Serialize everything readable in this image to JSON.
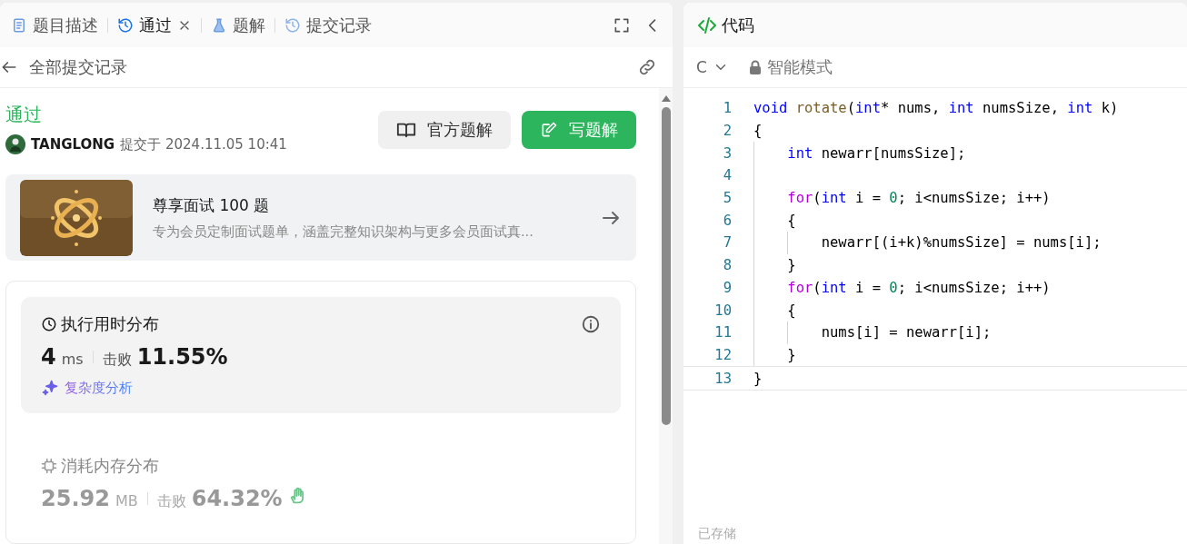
{
  "left_panel": {
    "tabs": [
      {
        "label": "题目描述",
        "kind": "document",
        "selected": false,
        "closable": false
      },
      {
        "label": "通过",
        "kind": "history",
        "selected": true,
        "closable": true
      },
      {
        "label": "题解",
        "kind": "flask",
        "selected": false,
        "closable": false
      },
      {
        "label": "提交记录",
        "kind": "history",
        "selected": false,
        "closable": false
      }
    ],
    "subheader": {
      "title": "全部提交记录"
    },
    "submission": {
      "status": "通过",
      "author": "TANGLONG",
      "submitted": "提交于 2024.11.05 10:41",
      "buttons": [
        {
          "label": "官方题解",
          "kind": "secondary"
        },
        {
          "label": "写题解",
          "kind": "primary"
        }
      ]
    },
    "promo": {
      "title": "尊享面试 100 题",
      "description": "专为会员定制面试题单，涵盖完整知识架构与更多会员面试真..."
    },
    "stats": [
      {
        "kind": "runtime",
        "title": "执行用时分布",
        "value": "4",
        "unit": "ms",
        "beat_label": "击败",
        "beat": "11.55%",
        "link": "复杂度分析",
        "selected": true
      },
      {
        "kind": "memory",
        "title": "消耗内存分布",
        "value": "25.92",
        "unit": "MB",
        "beat_label": "击败",
        "beat": "64.32%",
        "selected": false
      }
    ]
  },
  "code_panel": {
    "title": "代码",
    "language": "C",
    "mode": "智能模式",
    "status": "已存储",
    "lines": [
      {
        "number": "1",
        "tokens": [
          {
            "text": "void ",
            "kind": "keyword"
          },
          {
            "text": "rotate",
            "kind": "function"
          },
          {
            "text": "(",
            "kind": "plain"
          },
          {
            "text": "int",
            "kind": "keyword"
          },
          {
            "text": "* nums, ",
            "kind": "plain"
          },
          {
            "text": "int",
            "kind": "keyword"
          },
          {
            "text": " numsSize, ",
            "kind": "plain"
          },
          {
            "text": "int",
            "kind": "keyword"
          },
          {
            "text": " k)",
            "kind": "plain"
          }
        ]
      },
      {
        "number": "2",
        "tokens": [
          {
            "text": "{",
            "kind": "plain"
          }
        ]
      },
      {
        "number": "3",
        "tokens": [
          {
            "text": "    int",
            "kind": "keyword"
          },
          {
            "text": " newarr[numsSize];",
            "kind": "plain"
          }
        ]
      },
      {
        "number": "4"
      },
      {
        "number": "5",
        "tokens": [
          {
            "text": "    for",
            "kind": "control"
          },
          {
            "text": "(",
            "kind": "plain"
          },
          {
            "text": "int",
            "kind": "keyword"
          },
          {
            "text": " i = ",
            "kind": "plain"
          },
          {
            "text": "0",
            "kind": "number"
          },
          {
            "text": "; i<numsSize; i++)",
            "kind": "plain"
          }
        ]
      },
      {
        "number": "6",
        "tokens": [
          {
            "text": "    {",
            "kind": "plain"
          }
        ]
      },
      {
        "number": "7",
        "tokens": [
          {
            "text": "        newarr[(i+k)%numsSize] = nums[i];",
            "kind": "plain"
          }
        ]
      },
      {
        "number": "8",
        "tokens": [
          {
            "text": "    }",
            "kind": "plain"
          }
        ]
      },
      {
        "number": "9",
        "tokens": [
          {
            "text": "    for",
            "kind": "control"
          },
          {
            "text": "(",
            "kind": "plain"
          },
          {
            "text": "int",
            "kind": "keyword"
          },
          {
            "text": " i = ",
            "kind": "plain"
          },
          {
            "text": "0",
            "kind": "number"
          },
          {
            "text": "; i<numsSize; i++)",
            "kind": "plain"
          }
        ]
      },
      {
        "number": "10",
        "tokens": [
          {
            "text": "    {",
            "kind": "plain"
          }
        ]
      },
      {
        "number": "11",
        "tokens": [
          {
            "text": "        nums[i] = newarr[i];",
            "kind": "plain"
          }
        ]
      },
      {
        "number": "12",
        "tokens": [
          {
            "text": "    }",
            "kind": "plain"
          }
        ]
      },
      {
        "number": "13",
        "tokens": [
          {
            "text": "}",
            "kind": "plain"
          }
        ]
      }
    ]
  }
}
